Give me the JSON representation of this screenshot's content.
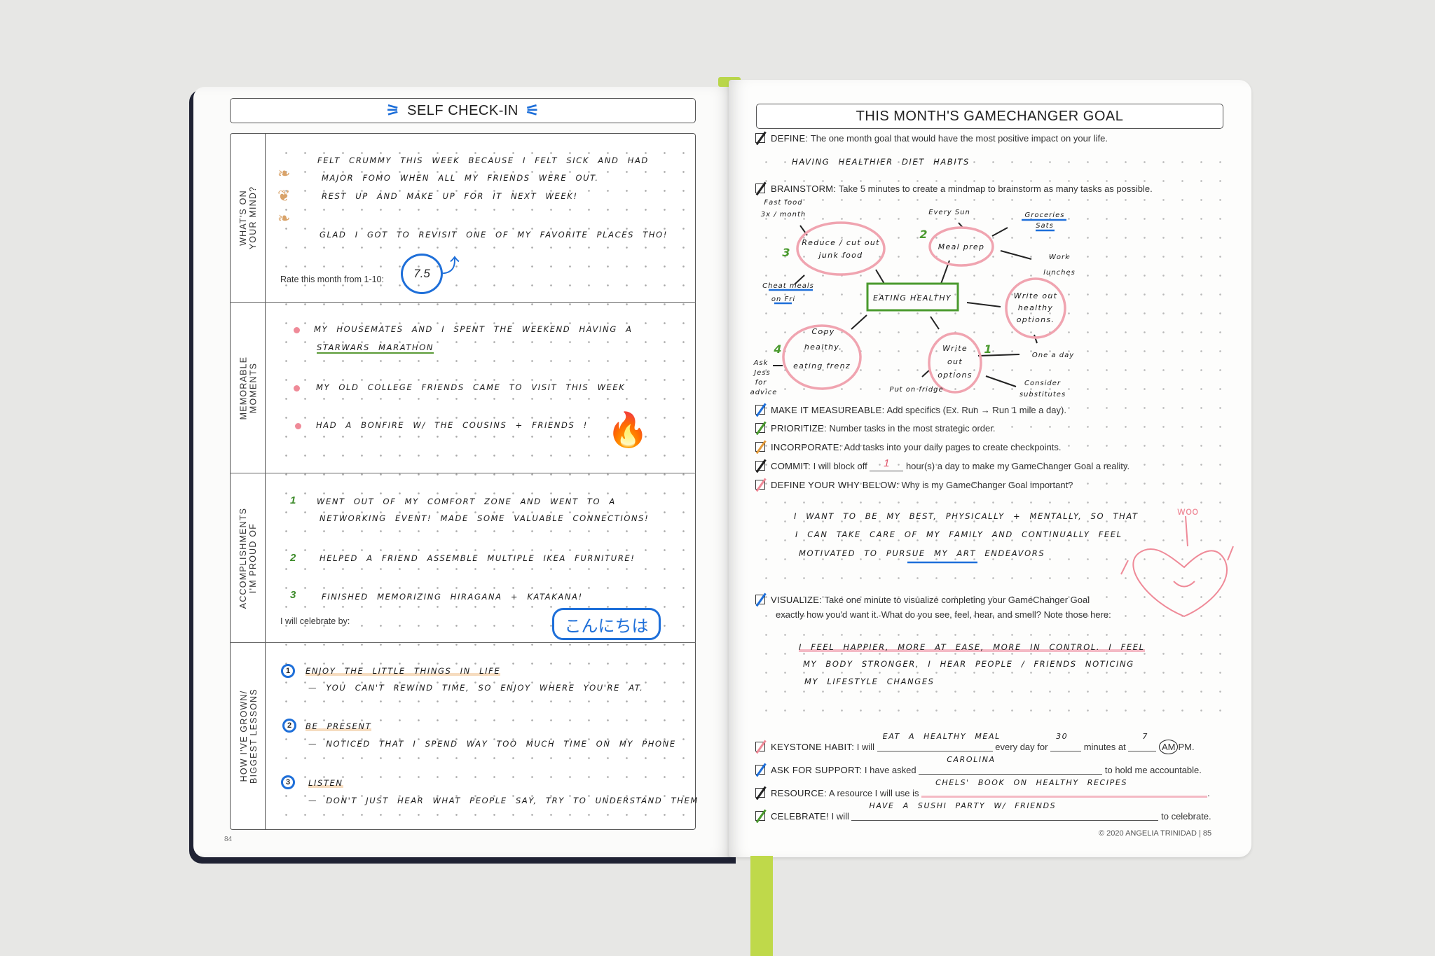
{
  "left_page": {
    "header": "SELF CHECK-IN",
    "page_number": "84",
    "sections": [
      {
        "label": "WHAT'S ON\nYOUR MIND?",
        "lines": [
          "Felt crummy this week because I felt sick and had",
          "major FOMO when all my friends were out.",
          "Rest up and make up for it next week!",
          "Glad I got to revisit one of my favorite places tho!"
        ],
        "rate_label": "Rate this month from 1-10:",
        "rating": "7.5"
      },
      {
        "label": "MEMORABLE\nMOMENTS",
        "items": [
          "My housemates and I spent the weekend having a",
          "Starwars marathon",
          "My old college friends came to visit this week",
          "Had a bonfire w/ the cousins + friends !"
        ]
      },
      {
        "label": "ACCOMPLISHMENTS\nI'M PROUD OF",
        "items": [
          {
            "number": "1",
            "lines": [
              "Went out of my comfort zone and went to a",
              "networking event! Made some valuable connections!"
            ]
          },
          {
            "number": "2",
            "lines": [
              "Helped a friend assemble multiple IKEA furniture!"
            ]
          },
          {
            "number": "3",
            "lines": [
              "Finished memorizing hiragana + katakana!"
            ]
          }
        ],
        "celebrate_label": "I will celebrate by:",
        "celebrate_value": "こんにちは"
      },
      {
        "label": "HOW I'VE GROWN/\nBIGGEST LESSONS",
        "items": [
          {
            "number": "1",
            "title": "Enjoy the little things in life",
            "detail": "— You can't rewind time, so enjoy where you're at."
          },
          {
            "number": "2",
            "title": "Be present",
            "detail": "— Noticed that I spend way too much time on my phone"
          },
          {
            "number": "3",
            "title": "Listen",
            "detail": "— Don't just hear what people say, try to understand them"
          }
        ]
      }
    ]
  },
  "right_page": {
    "header": "THIS MONTH'S GAMECHANGER GOAL",
    "define": {
      "label": "DEFINE:",
      "text": "The one month goal that would have the most positive impact on your life.",
      "answer": "Having healthier diet habits"
    },
    "brainstorm": {
      "label": "BRAINSTORM:",
      "text": "Take 5 minutes to create a mindmap to brainstorm as many tasks as possible."
    },
    "mindmap": {
      "center": "Eating healthy",
      "nodes": [
        {
          "number": "3",
          "lines": [
            "Reduce / cut out",
            "junk food"
          ],
          "notes": [
            "Fast food",
            "3x / month",
            "Cheat meals",
            "on Fri"
          ]
        },
        {
          "number": "2",
          "lines": [
            "Meal prep"
          ],
          "notes": [
            "Every Sun",
            "Groceries",
            "Sats",
            "Work",
            "lunches"
          ]
        },
        {
          "number": "",
          "lines": [
            "Write out",
            "healthy",
            "options."
          ],
          "notes": []
        },
        {
          "number": "1",
          "lines": [
            "Write",
            "out",
            "options"
          ],
          "notes": [
            "One a day",
            "Consider",
            "substitutes",
            "Put on fridge"
          ]
        },
        {
          "number": "4",
          "lines": [
            "Copy",
            "healthy.",
            "eating frenz"
          ],
          "notes": [
            "Ask",
            "Jess",
            "for",
            "advice"
          ]
        }
      ]
    },
    "steps": [
      {
        "label": "MAKE IT MEASUREABLE:",
        "text": "Add specifics (Ex. Run → Run 1 mile a day).",
        "check_color": "#1e6fd9"
      },
      {
        "label": "PRIORITIZE:",
        "text": "Number tasks in the most strategic order.",
        "check_color": "#4a9a2e"
      },
      {
        "label": "INCORPORATE:",
        "text": "Add tasks into your daily pages to create checkpoints.",
        "check_color": "#e39a3a"
      },
      {
        "label": "COMMIT:",
        "text_before": "I will block off",
        "value": "1",
        "text_after": "hour(s) a day to make my GameChanger Goal a reality.",
        "check_color": "#222222"
      },
      {
        "label": "DEFINE YOUR WHY BELOW:",
        "text": "Why is my GameChanger Goal important?",
        "check_color": "#ef8a98"
      }
    ],
    "why_lines": [
      "I want to be my best, physically + mentally, so that",
      "I can take care of my family and continually feel",
      "motivated to pursue my art endeavors"
    ],
    "doodle_text": "woo",
    "visualize": {
      "label": "VISUALIZE:",
      "text1": "Take one minute to visualize completing your GameChanger Goal",
      "text2": "exactly how you'd want it. What do you see, feel, hear, and smell? Note those here:",
      "lines": [
        "I feel happier, more at ease, more in control. I feel",
        "my body stronger, I hear people / friends noticing",
        "my lifestyle changes"
      ]
    },
    "keystone": {
      "label": "KEYSTONE HABIT:",
      "t1": "I will",
      "habit": "Eat a healthy meal",
      "t2": "every day for",
      "minutes": "30",
      "t3": "minutes at",
      "time": "7",
      "am": "AM",
      "pm": "PM."
    },
    "support": {
      "label": "ASK FOR SUPPORT:",
      "t1": "I have asked",
      "person": "Carolina",
      "t2": "to hold me accountable."
    },
    "resource": {
      "label": "RESOURCE:",
      "t1": "A resource I will use is",
      "value": "Chels' book on healthy recipes",
      "t2": "."
    },
    "celebrate": {
      "label": "CELEBRATE!",
      "t1": "I will",
      "value": "Have a sushi party w/ friends",
      "t2": "to celebrate."
    },
    "footer": "© 2020 ANGELIA TRINIDAD | 85"
  },
  "colors": {
    "blue_ink": "#1e6fd9",
    "green_ink": "#4a9a2e",
    "pink_marker": "#ef8a98",
    "ribbon": "#bfd94a"
  }
}
